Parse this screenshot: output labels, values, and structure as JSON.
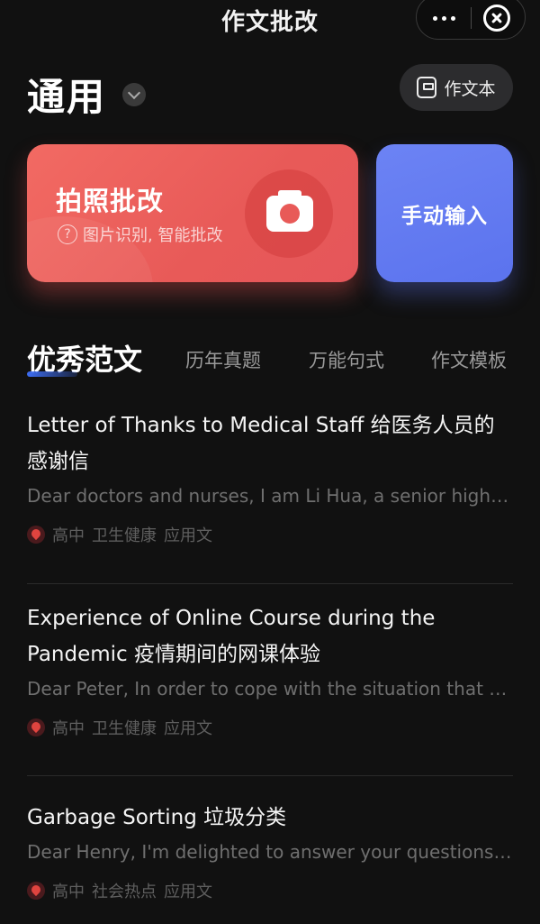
{
  "header": {
    "title": "作文批改"
  },
  "category": {
    "label": "通用"
  },
  "notebook_button": {
    "label": "作文本"
  },
  "photo_card": {
    "title": "拍照批改",
    "subtitle": "图片识别, 智能批改"
  },
  "manual_card": {
    "title": "手动输入"
  },
  "tabs": [
    {
      "label": "优秀范文",
      "active": true
    },
    {
      "label": "历年真题",
      "active": false
    },
    {
      "label": "万能句式",
      "active": false
    },
    {
      "label": "作文模板",
      "active": false
    }
  ],
  "essays": [
    {
      "title": "Letter of Thanks to Medical Staff 给医务人员的感谢信",
      "excerpt": "Dear doctors and nurses, I am Li Hua, a senior high school student...",
      "tags": [
        "高中",
        "卫生健康",
        "应用文"
      ]
    },
    {
      "title": "Experience of Online Course during the Pandemic 疫情期间的网课体验",
      "excerpt": "Dear Peter, In order to cope with the situation that we can't go to school...",
      "tags": [
        "高中",
        "卫生健康",
        "应用文"
      ]
    },
    {
      "title": "Garbage Sorting 垃圾分类",
      "excerpt": "Dear Henry, I'm delighted to answer your questions about garbage sorting...",
      "tags": [
        "高中",
        "社会热点",
        "应用文"
      ]
    }
  ],
  "colors": {
    "photo_card": "#ec5f5c",
    "manual_card": "#6478f1",
    "tab_indicator": "#3d6df2",
    "tag_icon": "#e0443f"
  }
}
